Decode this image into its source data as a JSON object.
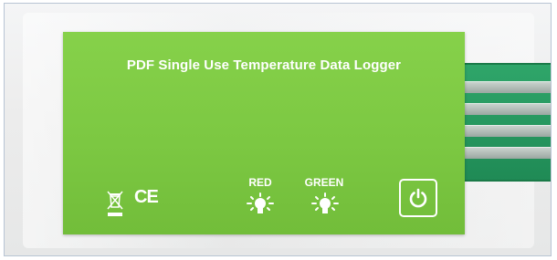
{
  "logger": {
    "title": "PDF Single Use Temperature Data Logger",
    "ce_mark": "CE",
    "led_red_label": "RED",
    "led_green_label": "GREEN"
  },
  "icons": {
    "disposal": "weee-crossed-bin-icon",
    "red_led": "lightbulb-icon",
    "green_led": "lightbulb-icon",
    "power": "power-icon"
  },
  "colors": {
    "logger_body": "#7cc842",
    "usb_connector": "#2a9b61",
    "text": "#ffffff"
  }
}
